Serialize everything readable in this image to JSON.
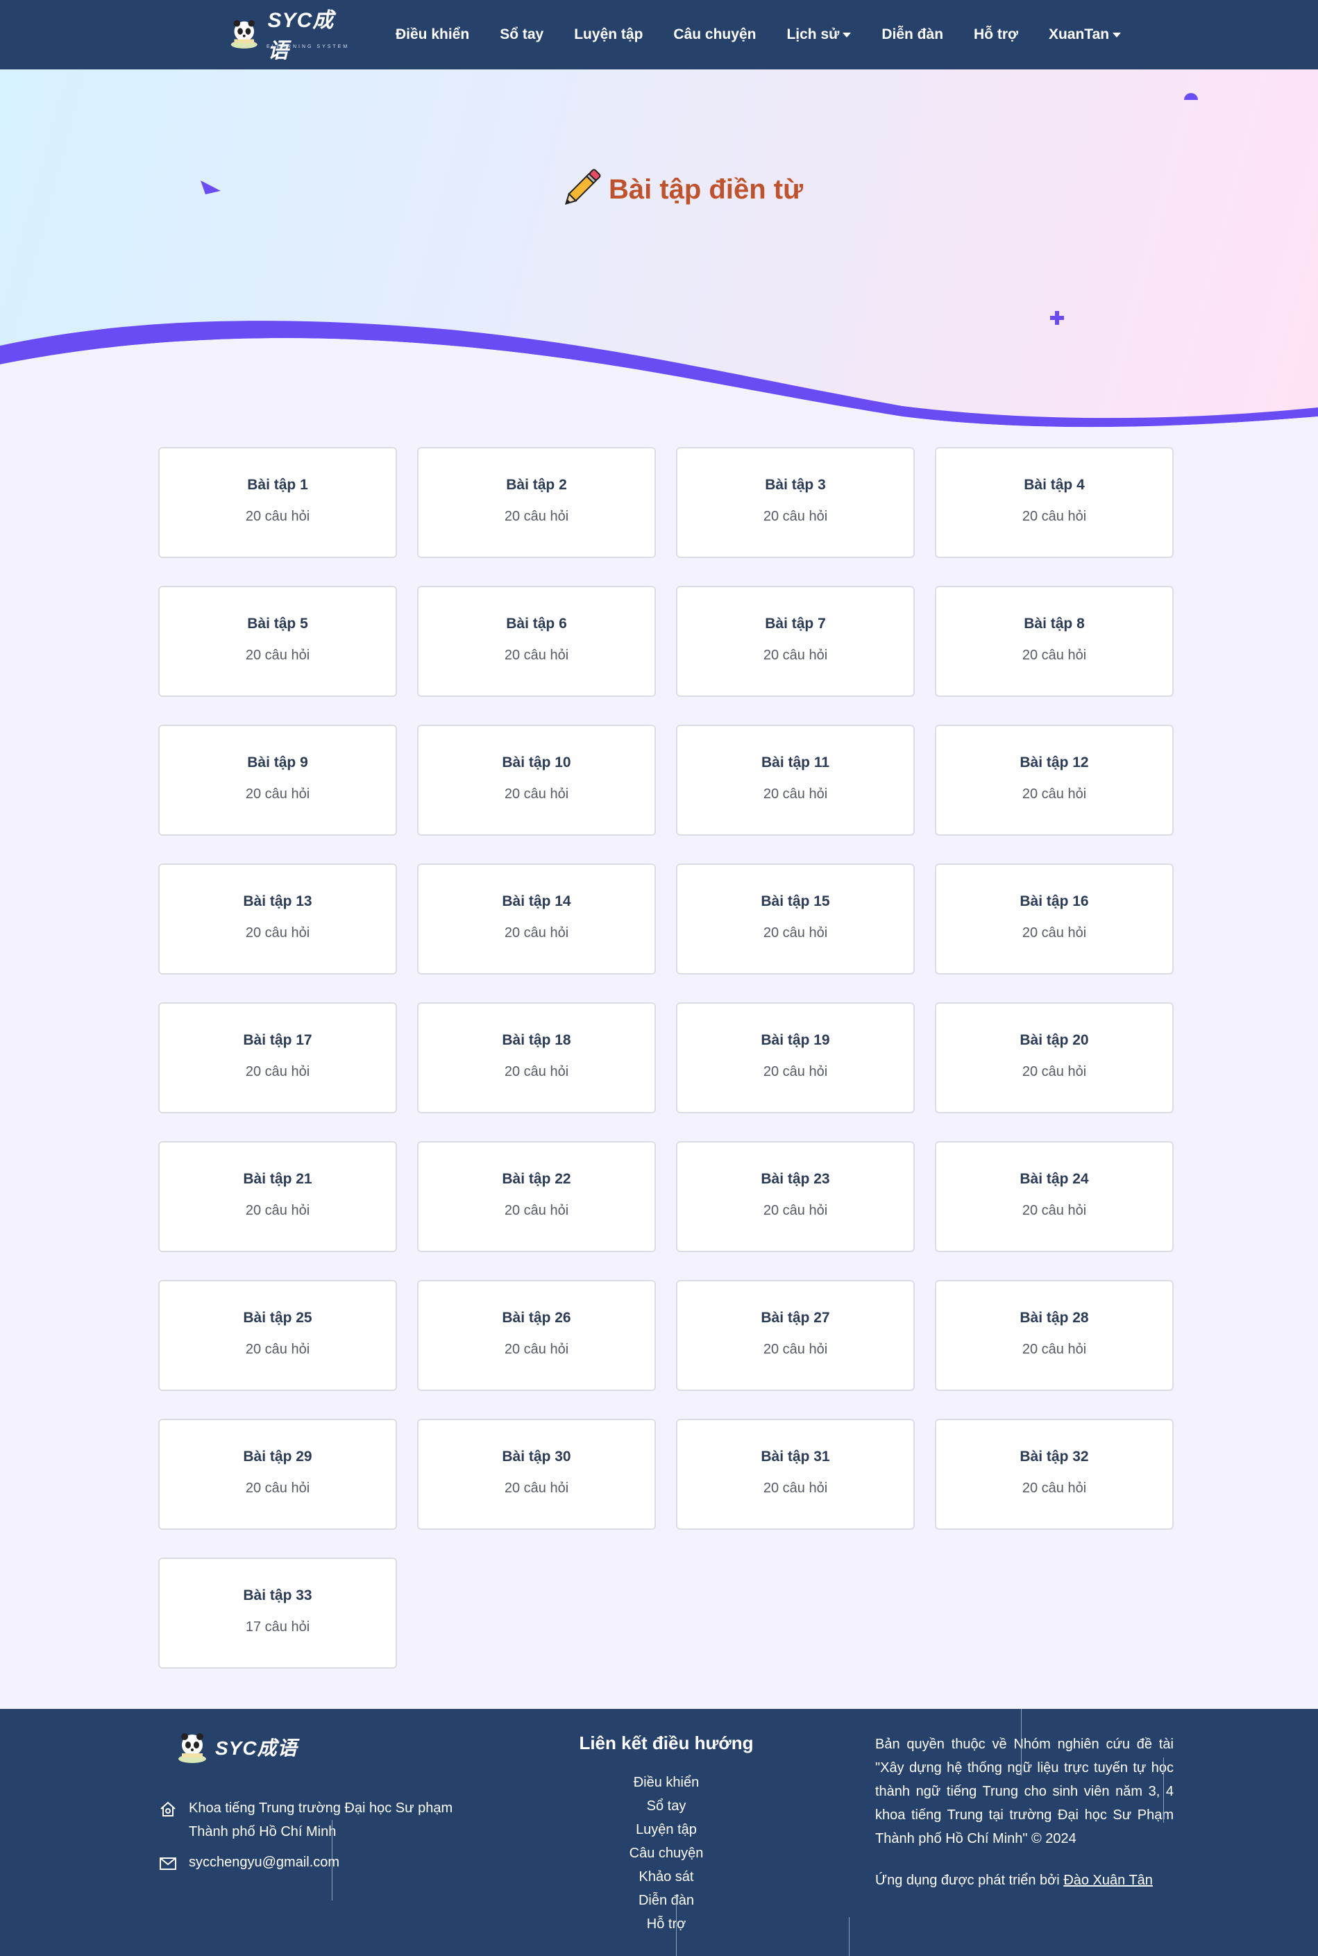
{
  "brand": {
    "name": "SYC成语",
    "tagline": "ELEARNING SYSTEM"
  },
  "nav": {
    "items": [
      {
        "label": "Điều khiển",
        "dropdown": false
      },
      {
        "label": "Sổ tay",
        "dropdown": false
      },
      {
        "label": "Luyện tập",
        "dropdown": false
      },
      {
        "label": "Câu chuyện",
        "dropdown": false
      },
      {
        "label": "Lịch sử",
        "dropdown": true
      },
      {
        "label": "Diễn đàn",
        "dropdown": false
      },
      {
        "label": "Hỗ trợ",
        "dropdown": false
      },
      {
        "label": "XuanTan",
        "dropdown": true
      }
    ]
  },
  "hero": {
    "title": "Bài tập điền từ",
    "icon": "pencil-icon"
  },
  "exercises": [
    {
      "title": "Bài tập 1",
      "count": "20 câu hỏi"
    },
    {
      "title": "Bài tập 2",
      "count": "20 câu hỏi"
    },
    {
      "title": "Bài tập 3",
      "count": "20 câu hỏi"
    },
    {
      "title": "Bài tập 4",
      "count": "20 câu hỏi"
    },
    {
      "title": "Bài tập 5",
      "count": "20 câu hỏi"
    },
    {
      "title": "Bài tập 6",
      "count": "20 câu hỏi"
    },
    {
      "title": "Bài tập 7",
      "count": "20 câu hỏi"
    },
    {
      "title": "Bài tập 8",
      "count": "20 câu hỏi"
    },
    {
      "title": "Bài tập 9",
      "count": "20 câu hỏi"
    },
    {
      "title": "Bài tập 10",
      "count": "20 câu hỏi"
    },
    {
      "title": "Bài tập 11",
      "count": "20 câu hỏi"
    },
    {
      "title": "Bài tập 12",
      "count": "20 câu hỏi"
    },
    {
      "title": "Bài tập 13",
      "count": "20 câu hỏi"
    },
    {
      "title": "Bài tập 14",
      "count": "20 câu hỏi"
    },
    {
      "title": "Bài tập 15",
      "count": "20 câu hỏi"
    },
    {
      "title": "Bài tập 16",
      "count": "20 câu hỏi"
    },
    {
      "title": "Bài tập 17",
      "count": "20 câu hỏi"
    },
    {
      "title": "Bài tập 18",
      "count": "20 câu hỏi"
    },
    {
      "title": "Bài tập 19",
      "count": "20 câu hỏi"
    },
    {
      "title": "Bài tập 20",
      "count": "20 câu hỏi"
    },
    {
      "title": "Bài tập 21",
      "count": "20 câu hỏi"
    },
    {
      "title": "Bài tập 22",
      "count": "20 câu hỏi"
    },
    {
      "title": "Bài tập 23",
      "count": "20 câu hỏi"
    },
    {
      "title": "Bài tập 24",
      "count": "20 câu hỏi"
    },
    {
      "title": "Bài tập 25",
      "count": "20 câu hỏi"
    },
    {
      "title": "Bài tập 26",
      "count": "20 câu hỏi"
    },
    {
      "title": "Bài tập 27",
      "count": "20 câu hỏi"
    },
    {
      "title": "Bài tập 28",
      "count": "20 câu hỏi"
    },
    {
      "title": "Bài tập 29",
      "count": "20 câu hỏi"
    },
    {
      "title": "Bài tập 30",
      "count": "20 câu hỏi"
    },
    {
      "title": "Bài tập 31",
      "count": "20 câu hỏi"
    },
    {
      "title": "Bài tập 32",
      "count": "20 câu hỏi"
    },
    {
      "title": "Bài tập 33",
      "count": "17 câu hỏi"
    }
  ],
  "footer": {
    "address": "Khoa tiếng Trung trường Đại học Sư phạm Thành phố Hồ Chí Minh",
    "email": "sycchengyu@gmail.com",
    "links_title": "Liên kết điều hướng",
    "links": [
      "Điều khiển",
      "Sổ tay",
      "Luyện tập",
      "Câu chuyện",
      "Khảo sát",
      "Diễn đàn",
      "Hỗ trợ"
    ],
    "copyright": "Bản quyền thuộc về Nhóm nghiên cứu đề tài \"Xây dựng hệ thống ngữ liệu trực tuyến tự học thành ngữ tiếng Trung cho sinh viên năm 3, 4 khoa tiếng Trung tại trường Đại học Sư Phạm Thành phố Hồ Chí Minh\" © 2024",
    "developer_prefix": "Ứng dụng được phát triển bởi",
    "developer_name": "Đào Xuân Tân"
  },
  "colors": {
    "navbar": "#26426a",
    "accent": "#6a4cf5",
    "title": "#c0522b",
    "card_border": "#dadce6"
  }
}
